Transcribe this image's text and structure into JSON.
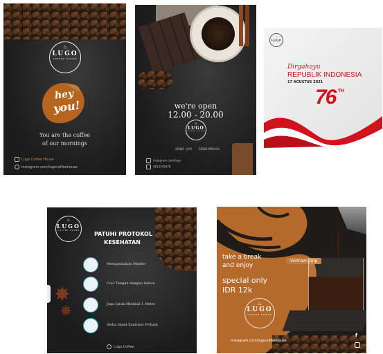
{
  "card1": {
    "logo_name": "LUGO",
    "logo_sub": "COFFEE HOUSE",
    "hey": "hey",
    "you": "you!",
    "tagline_1": "You are the coffee",
    "tagline_2": "of our mornings",
    "facebook": "Lugo Coffee House",
    "instagram": "instagram.com/lugocoffeehouse"
  },
  "card2": {
    "open_title": "we're open",
    "hours": "12.00 - 20.00",
    "logo_name": "LUGO",
    "logo_sub": "COFFEE HOUSE",
    "day_left": "SENIN - JUM",
    "day_right": "SENIN-MINGGU",
    "contact_1": "instagram.com/lugo",
    "contact_2": "0812345678"
  },
  "card3": {
    "logo_name": "LUGO",
    "logo_sub": "COFFEE HOUSE",
    "dirgahayu": "Dirgahayu",
    "republik": "REPUBLIK INDONESIA",
    "date": "17 AGUSTUS 2021",
    "number": "76",
    "th": "TH",
    "colors": {
      "red": "#d2121c",
      "white": "#ffffff"
    }
  },
  "card4": {
    "logo_name": "LUGO",
    "logo_sub": "COFFEE HOUSE",
    "title_1": "PATUHI PROTOKOL",
    "title_2": "KESEHATAN",
    "items": [
      {
        "icon": "mask-icon",
        "label": "Menggunakan Masker"
      },
      {
        "icon": "handwash-icon",
        "label": "Cuci Tangan dengan Sabun"
      },
      {
        "icon": "distance-icon",
        "label": "Jaga Jarak Minimal 1 Meter"
      },
      {
        "icon": "sanitizer-icon",
        "label": "Sedia Hand Sanitizer Pribadi"
      }
    ],
    "footer": "Lugo.Coffee"
  },
  "card5": {
    "badge": "Vietnam Drip",
    "headline_1": "take a break",
    "headline_2": "and enjoy",
    "special_1": "special only",
    "special_2": "IDR 12k",
    "logo_name": "LUGO",
    "logo_sub": "COFFEE HOUSE",
    "footer": "instagram.com/lugocoffeehouse",
    "accent": "#c27b3e"
  }
}
